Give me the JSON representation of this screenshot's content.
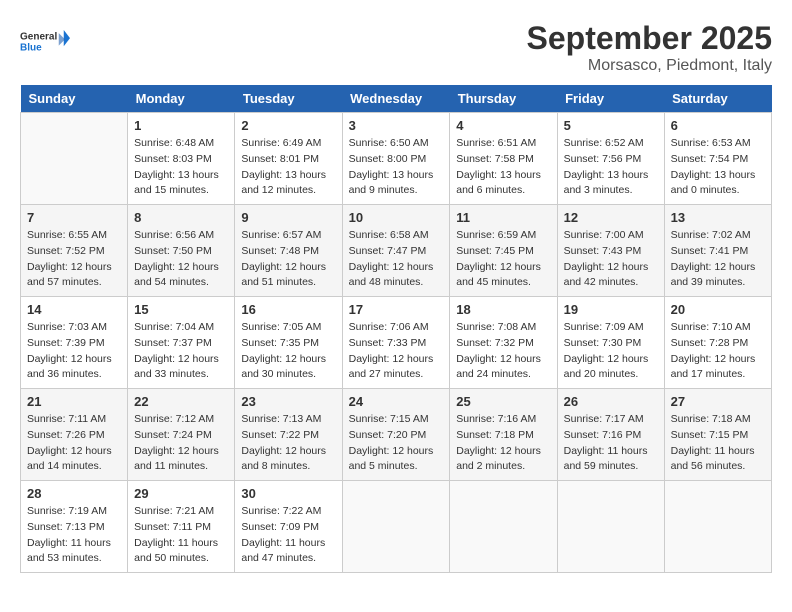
{
  "logo": {
    "text_general": "General",
    "text_blue": "Blue"
  },
  "title": "September 2025",
  "location": "Morsasco, Piedmont, Italy",
  "days_of_week": [
    "Sunday",
    "Monday",
    "Tuesday",
    "Wednesday",
    "Thursday",
    "Friday",
    "Saturday"
  ],
  "weeks": [
    [
      {
        "num": "",
        "info": ""
      },
      {
        "num": "1",
        "info": "Sunrise: 6:48 AM\nSunset: 8:03 PM\nDaylight: 13 hours\nand 15 minutes."
      },
      {
        "num": "2",
        "info": "Sunrise: 6:49 AM\nSunset: 8:01 PM\nDaylight: 13 hours\nand 12 minutes."
      },
      {
        "num": "3",
        "info": "Sunrise: 6:50 AM\nSunset: 8:00 PM\nDaylight: 13 hours\nand 9 minutes."
      },
      {
        "num": "4",
        "info": "Sunrise: 6:51 AM\nSunset: 7:58 PM\nDaylight: 13 hours\nand 6 minutes."
      },
      {
        "num": "5",
        "info": "Sunrise: 6:52 AM\nSunset: 7:56 PM\nDaylight: 13 hours\nand 3 minutes."
      },
      {
        "num": "6",
        "info": "Sunrise: 6:53 AM\nSunset: 7:54 PM\nDaylight: 13 hours\nand 0 minutes."
      }
    ],
    [
      {
        "num": "7",
        "info": "Sunrise: 6:55 AM\nSunset: 7:52 PM\nDaylight: 12 hours\nand 57 minutes."
      },
      {
        "num": "8",
        "info": "Sunrise: 6:56 AM\nSunset: 7:50 PM\nDaylight: 12 hours\nand 54 minutes."
      },
      {
        "num": "9",
        "info": "Sunrise: 6:57 AM\nSunset: 7:48 PM\nDaylight: 12 hours\nand 51 minutes."
      },
      {
        "num": "10",
        "info": "Sunrise: 6:58 AM\nSunset: 7:47 PM\nDaylight: 12 hours\nand 48 minutes."
      },
      {
        "num": "11",
        "info": "Sunrise: 6:59 AM\nSunset: 7:45 PM\nDaylight: 12 hours\nand 45 minutes."
      },
      {
        "num": "12",
        "info": "Sunrise: 7:00 AM\nSunset: 7:43 PM\nDaylight: 12 hours\nand 42 minutes."
      },
      {
        "num": "13",
        "info": "Sunrise: 7:02 AM\nSunset: 7:41 PM\nDaylight: 12 hours\nand 39 minutes."
      }
    ],
    [
      {
        "num": "14",
        "info": "Sunrise: 7:03 AM\nSunset: 7:39 PM\nDaylight: 12 hours\nand 36 minutes."
      },
      {
        "num": "15",
        "info": "Sunrise: 7:04 AM\nSunset: 7:37 PM\nDaylight: 12 hours\nand 33 minutes."
      },
      {
        "num": "16",
        "info": "Sunrise: 7:05 AM\nSunset: 7:35 PM\nDaylight: 12 hours\nand 30 minutes."
      },
      {
        "num": "17",
        "info": "Sunrise: 7:06 AM\nSunset: 7:33 PM\nDaylight: 12 hours\nand 27 minutes."
      },
      {
        "num": "18",
        "info": "Sunrise: 7:08 AM\nSunset: 7:32 PM\nDaylight: 12 hours\nand 24 minutes."
      },
      {
        "num": "19",
        "info": "Sunrise: 7:09 AM\nSunset: 7:30 PM\nDaylight: 12 hours\nand 20 minutes."
      },
      {
        "num": "20",
        "info": "Sunrise: 7:10 AM\nSunset: 7:28 PM\nDaylight: 12 hours\nand 17 minutes."
      }
    ],
    [
      {
        "num": "21",
        "info": "Sunrise: 7:11 AM\nSunset: 7:26 PM\nDaylight: 12 hours\nand 14 minutes."
      },
      {
        "num": "22",
        "info": "Sunrise: 7:12 AM\nSunset: 7:24 PM\nDaylight: 12 hours\nand 11 minutes."
      },
      {
        "num": "23",
        "info": "Sunrise: 7:13 AM\nSunset: 7:22 PM\nDaylight: 12 hours\nand 8 minutes."
      },
      {
        "num": "24",
        "info": "Sunrise: 7:15 AM\nSunset: 7:20 PM\nDaylight: 12 hours\nand 5 minutes."
      },
      {
        "num": "25",
        "info": "Sunrise: 7:16 AM\nSunset: 7:18 PM\nDaylight: 12 hours\nand 2 minutes."
      },
      {
        "num": "26",
        "info": "Sunrise: 7:17 AM\nSunset: 7:16 PM\nDaylight: 11 hours\nand 59 minutes."
      },
      {
        "num": "27",
        "info": "Sunrise: 7:18 AM\nSunset: 7:15 PM\nDaylight: 11 hours\nand 56 minutes."
      }
    ],
    [
      {
        "num": "28",
        "info": "Sunrise: 7:19 AM\nSunset: 7:13 PM\nDaylight: 11 hours\nand 53 minutes."
      },
      {
        "num": "29",
        "info": "Sunrise: 7:21 AM\nSunset: 7:11 PM\nDaylight: 11 hours\nand 50 minutes."
      },
      {
        "num": "30",
        "info": "Sunrise: 7:22 AM\nSunset: 7:09 PM\nDaylight: 11 hours\nand 47 minutes."
      },
      {
        "num": "",
        "info": ""
      },
      {
        "num": "",
        "info": ""
      },
      {
        "num": "",
        "info": ""
      },
      {
        "num": "",
        "info": ""
      }
    ]
  ]
}
